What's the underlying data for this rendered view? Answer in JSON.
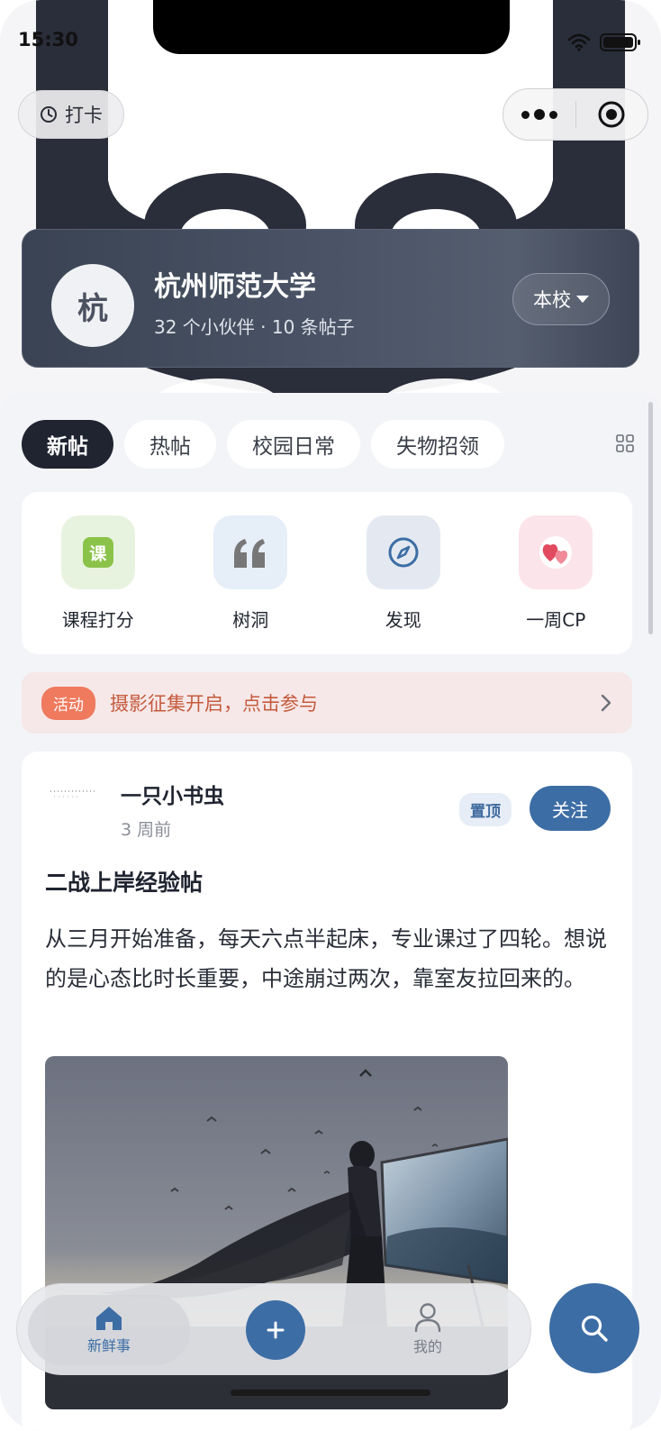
{
  "status_bar": {
    "time": "15:30"
  },
  "header": {
    "checkin_label": "打卡"
  },
  "school": {
    "avatar_char": "杭",
    "name": "杭州师范大学",
    "stats": "32 个小伙伴 · 10 条帖子",
    "scope_label": "本校"
  },
  "tabs": [
    {
      "label": "新帖",
      "active": true
    },
    {
      "label": "热帖",
      "active": false
    },
    {
      "label": "校园日常",
      "active": false
    },
    {
      "label": "失物招领",
      "active": false
    }
  ],
  "shortcuts": [
    {
      "label": "课程打分",
      "icon": "course-rating-icon",
      "icon_char": "课",
      "bg": "#e8f3df",
      "color": "#8bc34a"
    },
    {
      "label": "树洞",
      "icon": "quote-icon",
      "bg": "#e6eef8",
      "color": "#777777"
    },
    {
      "label": "发现",
      "icon": "compass-icon",
      "bg": "#e4e9f1",
      "color": "#3d6da5"
    },
    {
      "label": "一周CP",
      "icon": "hearts-icon",
      "bg": "#fbe4ea",
      "color": "#e24a5f"
    }
  ],
  "banner": {
    "badge": "活动",
    "text": "摄影征集开启，点击参与"
  },
  "post": {
    "author": "一只小书虫",
    "time": "3 周前",
    "pin_label": "置顶",
    "follow_label": "关注",
    "title": "二战上岸经验帖",
    "body": "从三月开始准备，每天六点半起床，专业课过了四轮。想说的是心态比时长重要，中途崩过两次，靠室友拉回来的。"
  },
  "bottom_nav": {
    "home_label": "新鲜事",
    "me_label": "我的"
  },
  "colors": {
    "accent": "#3d6da5",
    "banner_text": "#c55a3d",
    "banner_badge": "#ef7a5e"
  }
}
